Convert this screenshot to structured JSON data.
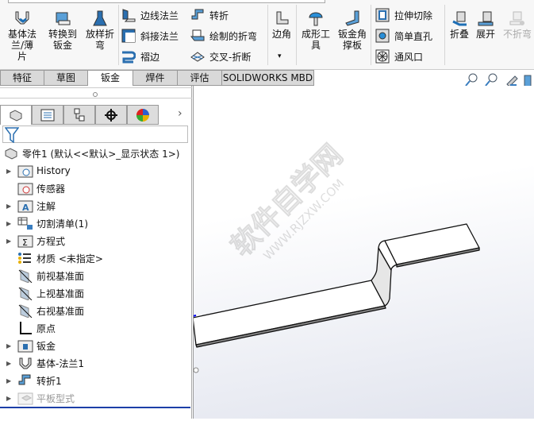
{
  "toolbar": {
    "big": [
      {
        "label1": "基体法",
        "label2": "兰/薄片"
      },
      {
        "label1": "转换到",
        "label2": "钣金"
      },
      {
        "label1": "放样折",
        "label2": "弯"
      },
      {
        "label1": "边角",
        "label2": ""
      },
      {
        "label1": "成形工",
        "label2": "具"
      },
      {
        "label1": "钣金角",
        "label2": "撑板"
      },
      {
        "label1": "折叠",
        "label2": ""
      },
      {
        "label1": "展开",
        "label2": ""
      },
      {
        "label1": "不折弯",
        "label2": ""
      }
    ],
    "small": [
      "边线法兰",
      "斜接法兰",
      "褶边",
      "转折",
      "绘制的折弯",
      "交叉-折断",
      "拉伸切除",
      "简单直孔",
      "通风口"
    ],
    "dropdown": "▾"
  },
  "tabs": [
    "特征",
    "草图",
    "钣金",
    "焊件",
    "评估",
    "SOLIDWORKS MBD"
  ],
  "active_tab": "钣金",
  "tree": {
    "root": "零件1  (默认<<默认>_显示状态 1>)",
    "items": [
      {
        "label": "History",
        "expand": true
      },
      {
        "label": "传感器",
        "expand": false
      },
      {
        "label": "注解",
        "expand": true
      },
      {
        "label": "切割清单(1)",
        "expand": true
      },
      {
        "label": "方程式",
        "expand": true
      },
      {
        "label": "材质 <未指定>",
        "expand": false
      },
      {
        "label": "前视基准面",
        "expand": false
      },
      {
        "label": "上视基准面",
        "expand": false
      },
      {
        "label": "右视基准面",
        "expand": false
      },
      {
        "label": "原点",
        "expand": false
      },
      {
        "label": "钣金",
        "expand": true
      },
      {
        "label": "基体-法兰1",
        "expand": true
      },
      {
        "label": "转折1",
        "expand": true
      },
      {
        "label": "平板型式",
        "expand": true,
        "disabled": true
      }
    ]
  },
  "watermark": {
    "line1": "软件自学网",
    "line2": "WWW.RJZXW.COM"
  },
  "colors": {
    "accent": "#1e6fb5",
    "selection_line": "#1c3fa8"
  }
}
